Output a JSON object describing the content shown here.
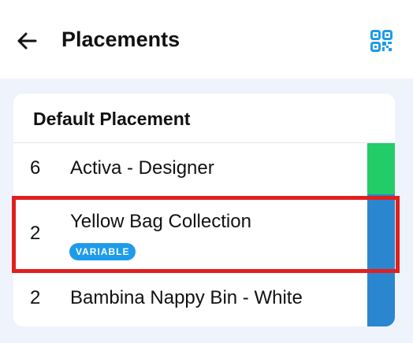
{
  "header": {
    "title": "Placements",
    "back_icon": "arrow-left-icon",
    "action_icon": "qr-code-icon",
    "accent_color": "#1E9BEA"
  },
  "card": {
    "title": "Default Placement",
    "items": [
      {
        "quantity": "6",
        "name": "Activa - Designer",
        "color": "#22CC66"
      },
      {
        "quantity": "2",
        "name": "Yellow Bag Collection",
        "badge": "VARIABLE",
        "color": "#2A87CF",
        "highlighted": true
      },
      {
        "quantity": "2",
        "name": "Bambina Nappy Bin - White",
        "color": "#2A87CF"
      }
    ]
  },
  "highlight_color": "#E02020"
}
